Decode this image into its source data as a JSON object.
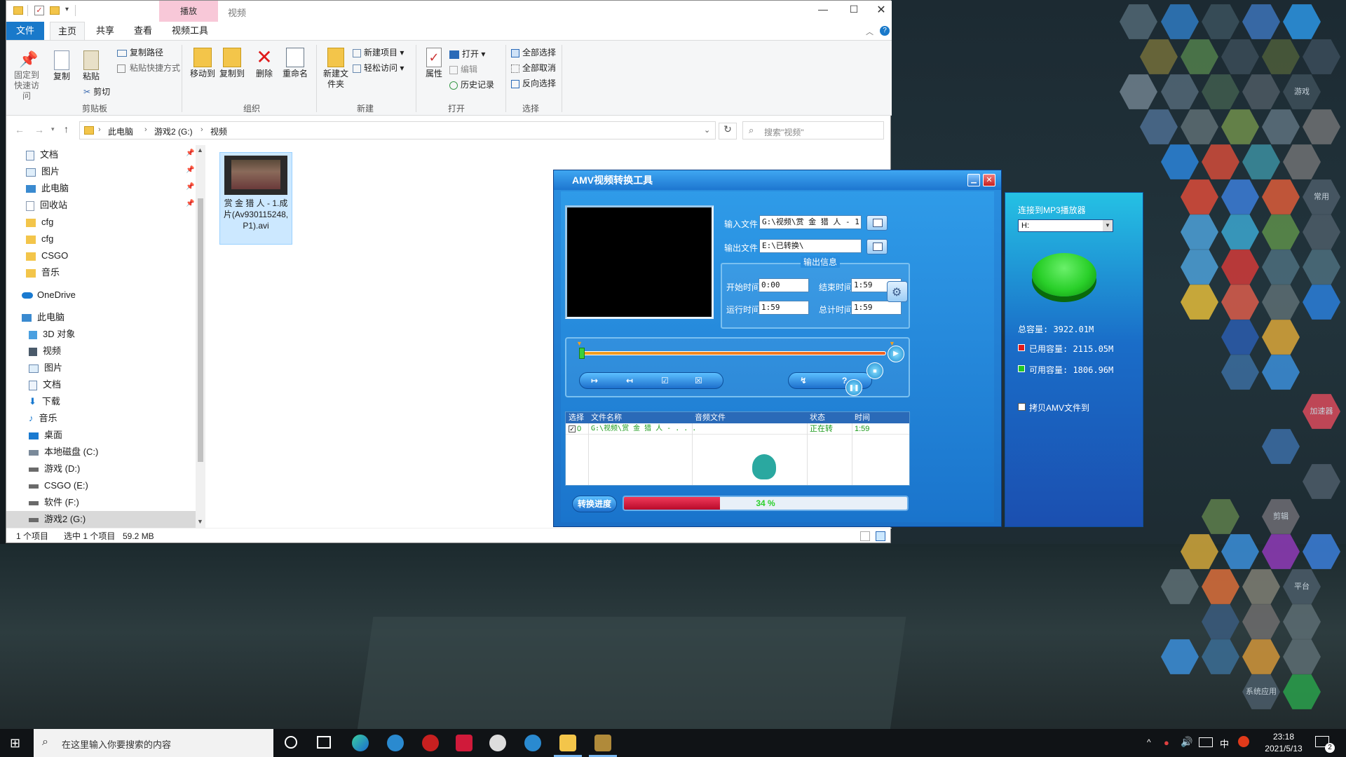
{
  "explorer": {
    "context_tab": "播放",
    "title": "视频",
    "tabs": [
      "文件",
      "主页",
      "共享",
      "查看",
      "视频工具"
    ],
    "ribbon": {
      "pin_label": "固定到快速访问",
      "copy_label": "复制",
      "paste_label": "粘贴",
      "copy_path": "复制路径",
      "paste_shortcut": "粘贴快捷方式",
      "cut": "剪切",
      "clipboard_group": "剪贴板",
      "move_to": "移动到",
      "copy_to": "复制到",
      "delete": "删除",
      "rename": "重命名",
      "organize_group": "组织",
      "new_folder": "新建文件夹",
      "new_item": "新建项目",
      "easy_access": "轻松访问",
      "new_group": "新建",
      "properties": "属性",
      "open": "打开",
      "edit": "编辑",
      "history": "历史记录",
      "open_group": "打开",
      "select_all": "全部选择",
      "select_none": "全部取消",
      "invert_select": "反向选择",
      "select_group": "选择"
    },
    "breadcrumb": [
      "此电脑",
      "游戏2 (G:)",
      "视频"
    ],
    "search_placeholder": "搜索\"视频\"",
    "nav": [
      {
        "label": "文档",
        "pin": true
      },
      {
        "label": "图片",
        "pin": true
      },
      {
        "label": "此电脑",
        "pin": true
      },
      {
        "label": "回收站",
        "pin": true
      },
      {
        "label": "cfg"
      },
      {
        "label": "cfg"
      },
      {
        "label": "CSGO"
      },
      {
        "label": "音乐"
      },
      {
        "label": "OneDrive"
      },
      {
        "label": "此电脑"
      },
      {
        "label": "3D 对象"
      },
      {
        "label": "视频"
      },
      {
        "label": "图片"
      },
      {
        "label": "文档"
      },
      {
        "label": "下载"
      },
      {
        "label": "音乐"
      },
      {
        "label": "桌面"
      },
      {
        "label": "本地磁盘 (C:)"
      },
      {
        "label": "游戏 (D:)"
      },
      {
        "label": "CSGO (E:)"
      },
      {
        "label": "软件 (F:)"
      },
      {
        "label": "游戏2 (G:)"
      }
    ],
    "file": {
      "name": "赏 金 猎 人 - 1.成片(Av930115248,P1).avi"
    },
    "status": {
      "count": "1 个项目",
      "selected": "选中 1 个项目",
      "size": "59.2 MB"
    }
  },
  "amv": {
    "title": "AMV视频转换工具",
    "input_label": "输入文件",
    "input_value": "G:\\视频\\赏  金  猎  人 - 1.成",
    "output_label": "输出文件",
    "output_value": "E:\\已转换\\",
    "info_title": "输出信息",
    "start_label": "开始时间",
    "start_value": "0:00",
    "end_label": "结束时间",
    "end_value": "1:59",
    "run_label": "运行时间",
    "run_value": "1:59",
    "total_label": "总计时间",
    "total_value": "1:59",
    "table_headers": [
      "选择",
      "文件名称",
      "音频文件",
      "状态",
      "时间"
    ],
    "row": {
      "index": "0",
      "name": "G:\\视频\\赏  金  猎  人 - . . .",
      "audio": "",
      "status": "正在转",
      "time": "1:59"
    },
    "progress_label": "转换进度",
    "progress_text": "34 %",
    "progress": 0.34
  },
  "side": {
    "title": "连接到MP3播放器",
    "drive": "H:",
    "total": "总容量:  3922.01M",
    "used": "已用容量:  2115.05M",
    "free": "可用容量:  1806.96M",
    "copy_label": "拷贝AMV文件到",
    "used_color": "#e01a1a",
    "free_color": "#22c822"
  },
  "desktop_labels": [
    "游戏",
    "常用",
    "加速器",
    "剪辑",
    "平台",
    "系统应用"
  ],
  "taskbar": {
    "search_placeholder": "在这里输入你要搜索的内容",
    "time": "23:18",
    "date": "2021/5/13",
    "ime": "中",
    "notif_count": "2"
  }
}
